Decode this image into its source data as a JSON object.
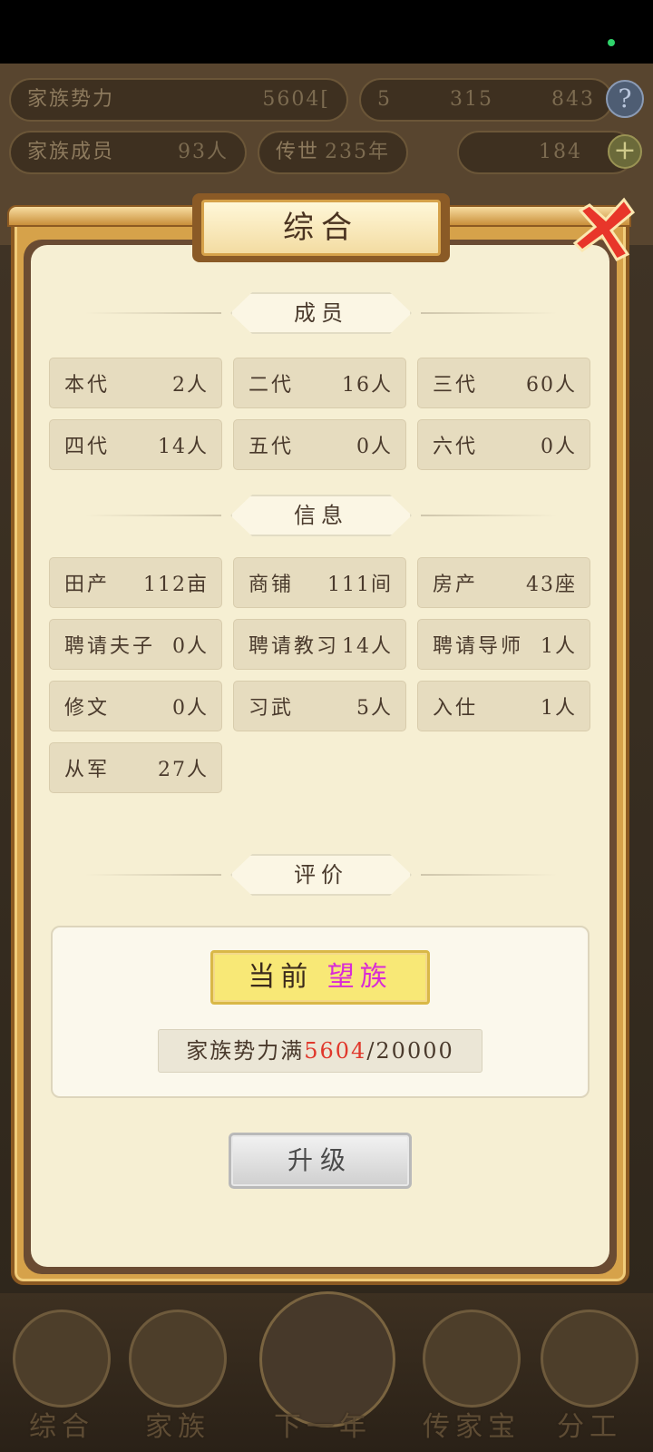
{
  "background": {
    "stats": [
      {
        "label": "家族势力",
        "value": "5604["
      },
      {
        "label": "家族成员",
        "value": "93人"
      },
      {
        "label": "传世",
        "value": "235年"
      }
    ],
    "currency": {
      "v1": "5",
      "v2": "315",
      "v3": "843",
      "gold": "184"
    },
    "help_icon": "question-icon",
    "plus_icon": "plus-icon"
  },
  "dialog": {
    "title": "综合",
    "close_icon": "close-icon",
    "sections": {
      "members": "成员",
      "info": "信息",
      "evaluation": "评价"
    },
    "members": [
      {
        "label": "本代",
        "value": "2人"
      },
      {
        "label": "二代",
        "value": "16人"
      },
      {
        "label": "三代",
        "value": "60人"
      },
      {
        "label": "四代",
        "value": "14人"
      },
      {
        "label": "五代",
        "value": "0人"
      },
      {
        "label": "六代",
        "value": "0人"
      }
    ],
    "info": [
      {
        "label": "田产",
        "value": "112亩"
      },
      {
        "label": "商铺",
        "value": "111间"
      },
      {
        "label": "房产",
        "value": "43座"
      },
      {
        "label": "聘请夫子",
        "value": "0人"
      },
      {
        "label": "聘请教习",
        "value": "14人"
      },
      {
        "label": "聘请导师",
        "value": "1人"
      },
      {
        "label": "修文",
        "value": "0人"
      },
      {
        "label": "习武",
        "value": "5人"
      },
      {
        "label": "入仕",
        "value": "1人"
      },
      {
        "label": "从军",
        "value": "27人"
      }
    ],
    "evaluation": {
      "current_label": "当前",
      "current_rank": "望族",
      "power_label": "家族势力满",
      "power_current": "5604",
      "power_target": "/20000"
    },
    "upgrade_label": "升级"
  },
  "nav": [
    {
      "label": "综合"
    },
    {
      "label": "家族"
    },
    {
      "label": "下一年"
    },
    {
      "label": "传家宝"
    },
    {
      "label": "分工"
    }
  ],
  "colors": {
    "panel": "#f6efd3",
    "frame": "#d6a24a",
    "rank": "#d92bd6",
    "power_current": "#e0372b"
  }
}
